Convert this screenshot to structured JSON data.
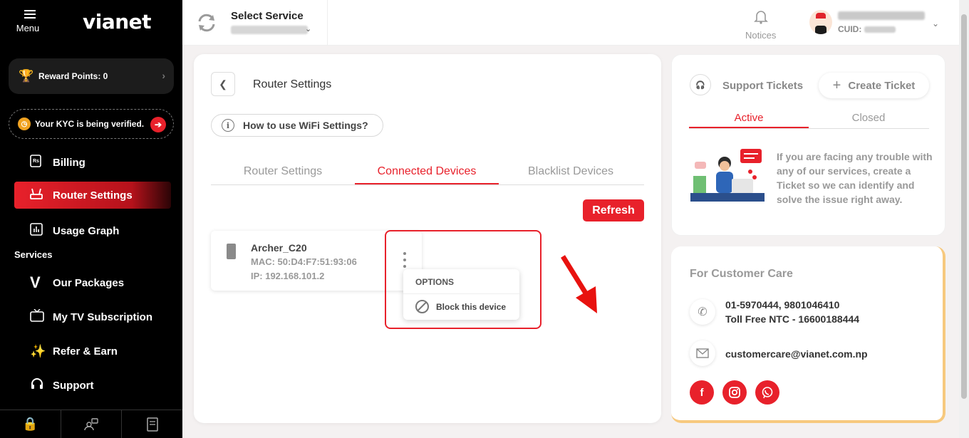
{
  "sidebar": {
    "menu_label": "Menu",
    "logo": "vianet",
    "reward": "Reward Points: 0",
    "kyc": "Your KYC is being verified.",
    "items": [
      {
        "label": "Billing",
        "icon": "receipt-icon"
      },
      {
        "label": "Router Settings",
        "icon": "router-icon",
        "active": true
      },
      {
        "label": "Usage Graph",
        "icon": "chart-icon"
      }
    ],
    "services_label": "Services",
    "service_items": [
      {
        "label": "Our Packages",
        "icon": "vianet-v-icon"
      },
      {
        "label": "My TV Subscription",
        "icon": "tv-icon"
      },
      {
        "label": "Refer & Earn",
        "icon": "sparkle-icon"
      },
      {
        "label": "Support",
        "icon": "headset-icon"
      }
    ],
    "bottom_icons": [
      "lock-shield-icon",
      "users-icon",
      "document-icon"
    ]
  },
  "header": {
    "select_service": "Select Service",
    "notices": "Notices",
    "cuid_label": "CUID:"
  },
  "main": {
    "title": "Router Settings",
    "howto": "How to use WiFi Settings?",
    "tabs": [
      "Router Settings",
      "Connected Devices",
      "Blacklist Devices"
    ],
    "active_tab": "Connected Devices",
    "refresh": "Refresh",
    "device": {
      "name": "Archer_C20",
      "mac": "MAC: 50:D4:F7:51:93:06",
      "ip": "IP: 192.168.101.2"
    },
    "options": {
      "header": "OPTIONS",
      "block": "Block this device"
    }
  },
  "support": {
    "title": "Support Tickets",
    "create": "Create Ticket",
    "tabs": [
      "Active",
      "Closed"
    ],
    "message": "If you are facing any trouble with any of our services, create a Ticket so we can identify and solve the issue right away."
  },
  "care": {
    "title": "For Customer Care",
    "phone1": "01-5970444, 9801046410",
    "phone2": "Toll Free NTC - 16600188444",
    "email": "customercare@vianet.com.np",
    "socials": [
      "facebook-icon",
      "instagram-icon",
      "viber-icon"
    ]
  },
  "colors": {
    "accent": "#e8212b",
    "sidebar_bg": "#000000",
    "care_border": "#f7c97e"
  }
}
